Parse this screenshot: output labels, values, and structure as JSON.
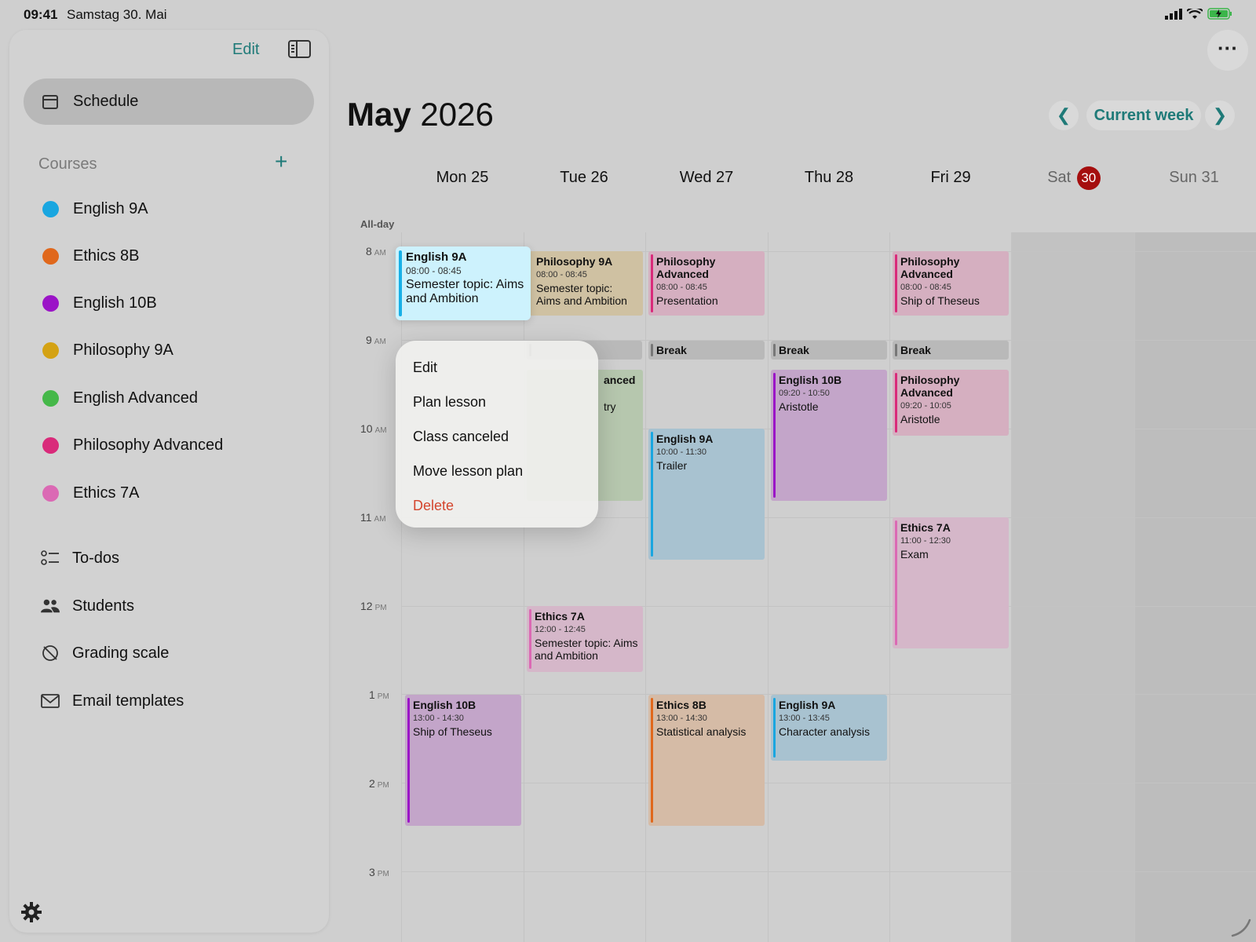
{
  "status_bar": {
    "time": "09:41",
    "date": "Samstag 30. Mai"
  },
  "sidebar": {
    "edit_label": "Edit",
    "schedule_label": "Schedule",
    "courses_header": "Courses",
    "add_icon": "plus-icon",
    "courses": [
      {
        "label": "English 9A",
        "color": "#19a6e0"
      },
      {
        "label": "Ethics 8B",
        "color": "#e0681c"
      },
      {
        "label": "English 10B",
        "color": "#9b14c7"
      },
      {
        "label": "Philosophy 9A",
        "color": "#d4a214"
      },
      {
        "label": "English Advanced",
        "color": "#45b849"
      },
      {
        "label": "Philosophy Advanced",
        "color": "#d92a7a"
      },
      {
        "label": "Ethics 7A",
        "color": "#db69b4"
      }
    ],
    "nav": [
      {
        "label": "To-dos",
        "icon": "checklist-icon"
      },
      {
        "label": "Students",
        "icon": "people-icon"
      },
      {
        "label": "Grading scale",
        "icon": "grading-scale-icon"
      },
      {
        "label": "Email templates",
        "icon": "envelope-icon"
      }
    ]
  },
  "header": {
    "month": "May",
    "year": "2026",
    "current_week_label": "Current week"
  },
  "days": [
    {
      "label": "Mon 25"
    },
    {
      "label": "Tue 26"
    },
    {
      "label": "Wed 27"
    },
    {
      "label": "Thu 28"
    },
    {
      "label": "Fri 29"
    },
    {
      "label": "Sat",
      "badge": "30"
    },
    {
      "label": "Sun 31"
    }
  ],
  "allday_label": "All-day",
  "hours": [
    {
      "num": "8",
      "suffix": "AM"
    },
    {
      "num": "9",
      "suffix": "AM"
    },
    {
      "num": "10",
      "suffix": "AM"
    },
    {
      "num": "11",
      "suffix": "AM"
    },
    {
      "num": "12",
      "suffix": "PM"
    },
    {
      "num": "1",
      "suffix": "PM"
    },
    {
      "num": "2",
      "suffix": "PM"
    },
    {
      "num": "3",
      "suffix": "PM"
    }
  ],
  "events": {
    "mon_english9a": {
      "title": "English 9A",
      "time": "08:00 - 08:45",
      "desc": "Semester topic: Aims and Ambition"
    },
    "tue_philosophy9a": {
      "title": "Philosophy 9A",
      "time": "08:00 - 08:45",
      "desc": "Semester topic: Aims and Ambition"
    },
    "wed_philadv": {
      "title": "Philosophy Advanced",
      "time": "08:00 - 08:45",
      "desc": "Presentation"
    },
    "fri_philadv1": {
      "title": "Philosophy Advanced",
      "time": "08:00 - 08:45",
      "desc": "Ship of Theseus"
    },
    "tue_engadv_partial_title": "anced",
    "tue_engadv_partial_desc": "try",
    "thu_english10b": {
      "title": "English 10B",
      "time": "09:20 - 10:50",
      "desc": "Aristotle"
    },
    "fri_philadv2": {
      "title": "Philosophy Advanced",
      "time": "09:20 - 10:05",
      "desc": "Aristotle"
    },
    "wed_english9a": {
      "title": "English 9A",
      "time": "10:00 - 11:30",
      "desc": "Trailer"
    },
    "fri_ethics7a": {
      "title": "Ethics 7A",
      "time": "11:00 - 12:30",
      "desc": "Exam"
    },
    "tue_ethics7a": {
      "title": "Ethics 7A",
      "time": "12:00 - 12:45",
      "desc": "Semester topic: Aims and Ambition"
    },
    "mon_english10b": {
      "title": "English 10B",
      "time": "13:00 - 14:30",
      "desc": "Ship of Theseus"
    },
    "wed_ethics8b": {
      "title": "Ethics 8B",
      "time": "13:00 - 14:30",
      "desc": "Statistical analysis"
    },
    "thu_english9a": {
      "title": "English 9A",
      "time": "13:00 - 13:45",
      "desc": "Character analysis"
    },
    "break_label": "Break"
  },
  "context_menu": {
    "items": [
      "Edit",
      "Plan lesson",
      "Class canceled",
      "Move lesson plan"
    ],
    "delete": "Delete"
  },
  "colors": {
    "accent": "#1f7a78",
    "today": "#a50e0e",
    "delete": "#d4452d"
  }
}
